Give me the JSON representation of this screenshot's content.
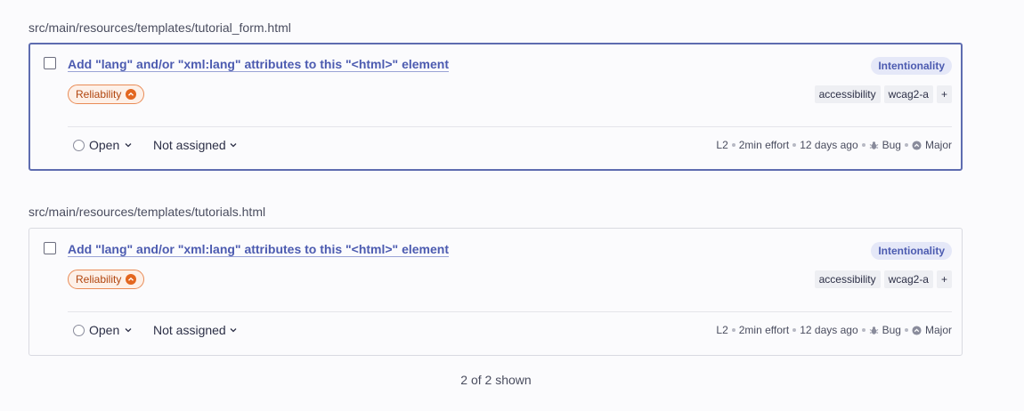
{
  "issues": [
    {
      "file_path": "src/main/resources/templates/tutorial_form.html",
      "title": "Add \"lang\" and/or \"xml:lang\" attributes to this \"<html>\" element",
      "attribute": "Intentionality",
      "quality": "Reliability",
      "tags": [
        "accessibility",
        "wcag2-a",
        "+"
      ],
      "status": "Open",
      "assignee": "Not assigned",
      "line": "L2",
      "effort": "2min effort",
      "age": "12 days ago",
      "type": "Bug",
      "severity": "Major",
      "selected": true
    },
    {
      "file_path": "src/main/resources/templates/tutorials.html",
      "title": "Add \"lang\" and/or \"xml:lang\" attributes to this \"<html>\" element",
      "attribute": "Intentionality",
      "quality": "Reliability",
      "tags": [
        "accessibility",
        "wcag2-a",
        "+"
      ],
      "status": "Open",
      "assignee": "Not assigned",
      "line": "L2",
      "effort": "2min effort",
      "age": "12 days ago",
      "type": "Bug",
      "severity": "Major",
      "selected": false
    }
  ],
  "footer": {
    "count_text": "2 of 2 shown"
  },
  "colors": {
    "accent": "#4c5bb0",
    "selected_border": "#5e6cb0",
    "reliability": "#e3661f",
    "attribute_bg": "#e5e8f8"
  },
  "icons": {
    "severity": "chevron-up-circle-icon",
    "type": "bug-icon",
    "status": "circle-icon",
    "dropdown": "chevron-down-icon"
  }
}
